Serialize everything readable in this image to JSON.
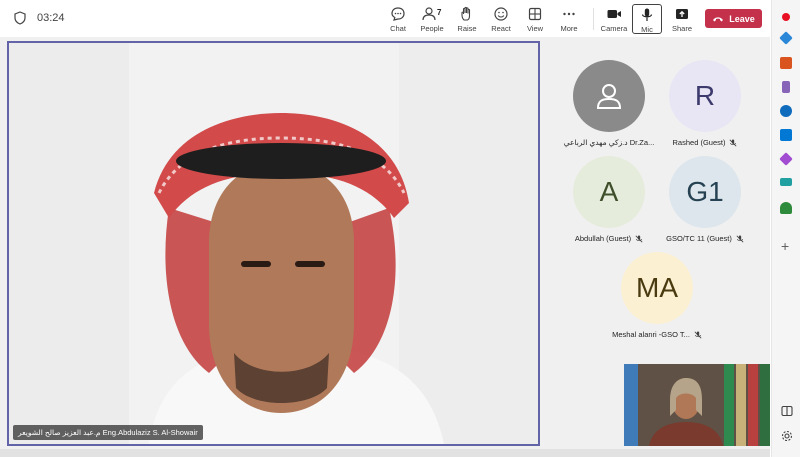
{
  "toolbar": {
    "timer": "03:24",
    "chat_label": "Chat",
    "people_label": "People",
    "people_count": "7",
    "raise_label": "Raise",
    "react_label": "React",
    "view_label": "View",
    "more_label": "More",
    "camera_label": "Camera",
    "mic_label": "Mic",
    "share_label": "Share",
    "leave_label": "Leave",
    "leave_color": "#c4314b"
  },
  "main_video": {
    "name": "م.عبد العزيز صالح الشويعر Eng.Abdulaziz S. Al-Showair",
    "border_color": "#6264a7"
  },
  "participants": [
    {
      "initials": "",
      "name": "د.زكي مهدي الرباعي Dr.Za...",
      "avatar_color": "#8a8a8a",
      "icon": "person-icon",
      "muted": false
    },
    {
      "initials": "R",
      "name": "Rashed (Guest)",
      "avatar_color": "#e8e6f4",
      "muted": true
    },
    {
      "initials": "A",
      "name": "Abdullah (Guest)",
      "avatar_color": "#e6ecdc",
      "muted": true
    },
    {
      "initials": "G1",
      "name": "GSO/TC 11 (Guest)",
      "avatar_color": "#dce6ec",
      "muted": true
    },
    {
      "initials": "MA",
      "name": "Meshal alanri -GSO T...",
      "avatar_color": "#fbf0d2",
      "muted": true
    }
  ]
}
